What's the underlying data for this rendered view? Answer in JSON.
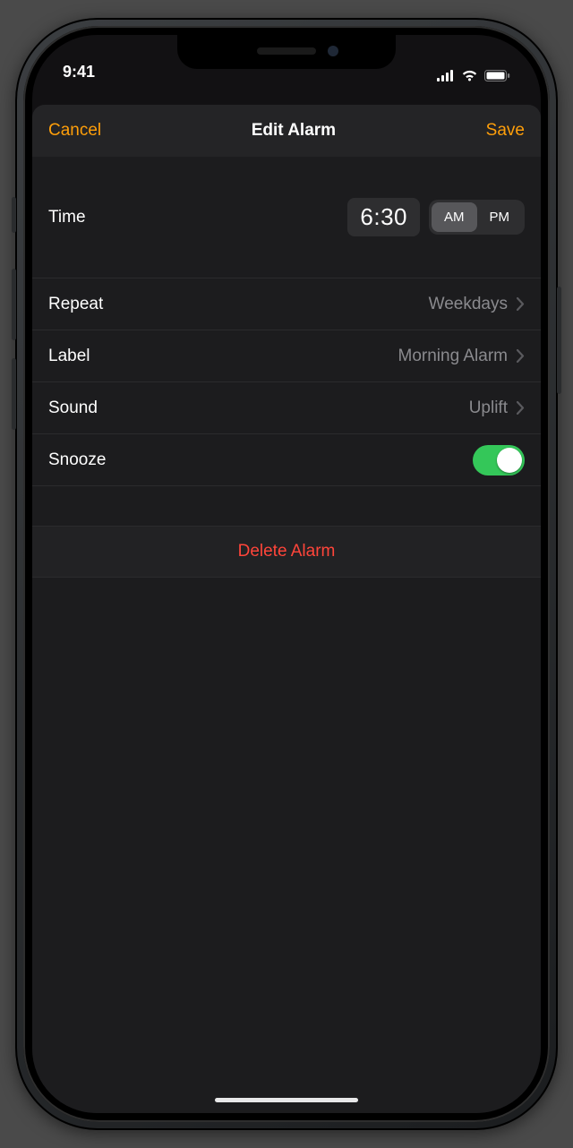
{
  "status": {
    "time": "9:41"
  },
  "nav": {
    "cancel": "Cancel",
    "title": "Edit Alarm",
    "save": "Save"
  },
  "time": {
    "label": "Time",
    "value": "6:30",
    "am": "AM",
    "pm": "PM",
    "selected": "AM"
  },
  "rows": {
    "repeat": {
      "label": "Repeat",
      "value": "Weekdays"
    },
    "label": {
      "label": "Label",
      "value": "Morning Alarm"
    },
    "sound": {
      "label": "Sound",
      "value": "Uplift"
    },
    "snooze": {
      "label": "Snooze",
      "on": true
    }
  },
  "delete": {
    "label": "Delete Alarm"
  },
  "colors": {
    "accent": "#ff9f0a",
    "destructive": "#ff453a",
    "switchOn": "#34c759"
  }
}
